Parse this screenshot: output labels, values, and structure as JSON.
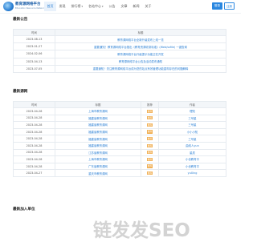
{
  "header": {
    "title": "教育源网络平台",
    "subtitle": "Education Resource Network Platform",
    "nav": [
      {
        "label": "首页",
        "active": true
      },
      {
        "label": "发现",
        "active": false
      },
      {
        "label": "排行榜",
        "active": false,
        "dropdown": true
      },
      {
        "label": "名站中心",
        "active": false,
        "dropdown": true
      },
      {
        "label": "公告",
        "active": false
      },
      {
        "label": "文章",
        "active": false
      },
      {
        "label": "新闻",
        "active": false
      },
      {
        "label": "关于",
        "active": false
      }
    ],
    "login_label": "登录",
    "register_label": "注册"
  },
  "notice": {
    "title": "最新公告",
    "headers": [
      "时间",
      "标题"
    ],
    "rows": [
      {
        "date": "2023-08-13",
        "title": "教育源网络平台全新升级发布上线一览"
      },
      {
        "date": "2023-01-27",
        "title": "重要通知！教育源网络平台推出《教育资源收录标准》(Web/ssfile) 一键查询"
      },
      {
        "date": "2024-02-06",
        "title": "教育源网络平台升级提示功能正在开发"
      },
      {
        "date": "2023-04-13",
        "title": "教育源网络平台公告及活动发布通知"
      },
      {
        "date": "2023-07-05",
        "title": "重要通知！关注教育源网络平台成为您的站点有效管理功能重构存在的问题解释"
      }
    ]
  },
  "latest": {
    "title": "最新源网",
    "headers": [
      "时间",
      "标题",
      "推荐",
      "作者"
    ],
    "rows": [
      {
        "date": "2023-04-28",
        "title": "上海市教育源网",
        "tag": "推荐",
        "author": "理知"
      },
      {
        "date": "2023-04-28",
        "title": "福建省教育源网",
        "tag": "推荐",
        "author": "三号星"
      },
      {
        "date": "2023-04-28",
        "title": "福建省教育源网",
        "tag": "推荐",
        "author": "三号星"
      },
      {
        "date": "2023-04-28",
        "title": "福建省教育源网",
        "tag": "推荐",
        "author": "小小小知"
      },
      {
        "date": "2023-04-28",
        "title": "福建省教育源网",
        "tag": "推荐",
        "author": "三号星"
      },
      {
        "date": "2023-04-28",
        "title": "福建省教育源网",
        "tag": "推荐",
        "author": "曲线人yun"
      },
      {
        "date": "2023-04-28",
        "title": "江苏省教育源网",
        "tag": "推荐",
        "author": "星辰"
      },
      {
        "date": "2023-04-28",
        "title": "上海市教育源网",
        "tag": "推荐",
        "author": "小也教育平"
      },
      {
        "date": "2023-04-28",
        "title": "广东省教育源网",
        "tag": "推荐",
        "author": "小也教育平"
      },
      {
        "date": "2023-04-27",
        "title": "重庆市教育源网",
        "tag": "推荐",
        "author": "yuXing"
      }
    ]
  },
  "units": {
    "title": "最新加入单位"
  },
  "watermark": "链发发SEO"
}
